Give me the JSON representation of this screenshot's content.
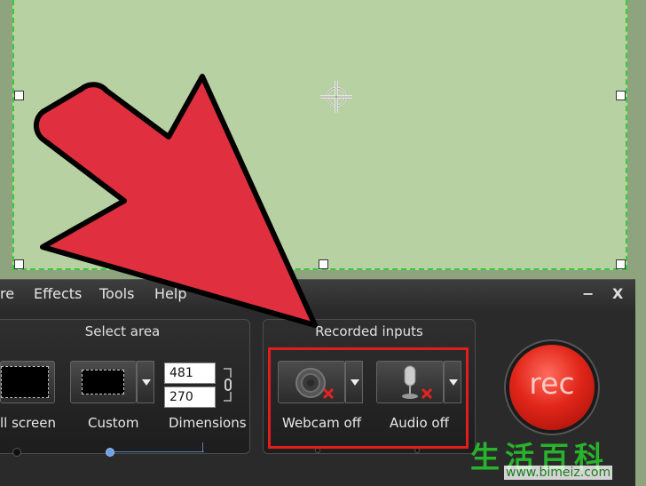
{
  "menu": {
    "items": [
      "re",
      "Effects",
      "Tools",
      "Help"
    ],
    "minimize_label": "−",
    "close_label": "X"
  },
  "select_area": {
    "title": "Select area",
    "full_screen_label": "ll screen",
    "custom_label": "Custom",
    "dimensions_label": "Dimensions",
    "width_value": "481",
    "height_value": "270"
  },
  "recorded_inputs": {
    "title": "Recorded inputs",
    "webcam_label": "Webcam off",
    "audio_label": "Audio off"
  },
  "record": {
    "label": "rec"
  },
  "watermark": {
    "chars": "生活百科",
    "url": "www.bimeiz.com"
  },
  "colors": {
    "capture_border": "#36c93a",
    "highlight": "#e31c1c",
    "arrow": "#e0303f",
    "rec_button": "#e2261a"
  },
  "icons": [
    "move-crosshair-icon",
    "webcam-icon",
    "microphone-icon",
    "disabled-x-icon",
    "link-chain-icon",
    "chevron-down-icon"
  ]
}
